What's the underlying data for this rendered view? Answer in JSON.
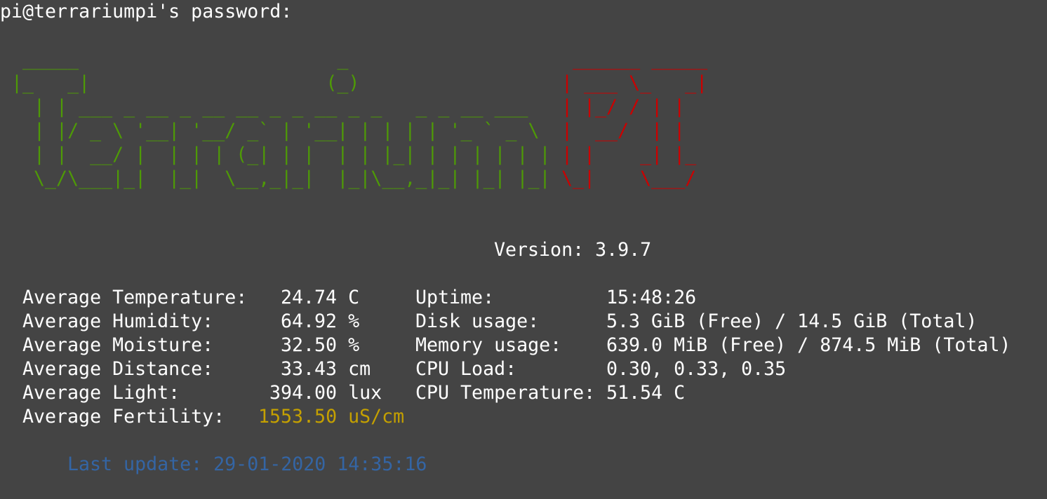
{
  "prompt": "pi@terrariumpi's password:",
  "logo": {
    "terrarium_lines": [
      "  _____                       _",
      " |_   _|                     (_)",
      "   | | ___ _ __ _ __ __ _ _ __ _ _   _ _ __ ___",
      "   | |/ _ \\ '__| '__/ _` | '__| | | | | '_ ` _ \\",
      "   | |  __/ |  | | | (_| | |  | | |_| | | | | | |",
      "   \\_/\\___|_|  |_|  \\__,_|_|  |_|\\__,_|_| |_| |_|"
    ],
    "pi_lines": [
      " ______ _____",
      "| ___ \\_   _|",
      "| |_/ / | |",
      "|  __/  | |",
      "| |    _| |_",
      "\\_|    \\___/"
    ]
  },
  "version": {
    "label": "Version:",
    "value": "3.9.7"
  },
  "sensors": [
    {
      "label": "Average Temperature:",
      "value": "24.74",
      "unit": "C",
      "highlight": false
    },
    {
      "label": "Average Humidity:",
      "value": "64.92",
      "unit": "%",
      "highlight": false
    },
    {
      "label": "Average Moisture:",
      "value": "32.50",
      "unit": "%",
      "highlight": false
    },
    {
      "label": "Average Distance:",
      "value": "33.43",
      "unit": "cm",
      "highlight": false
    },
    {
      "label": "Average Light:",
      "value": "394.00",
      "unit": "lux",
      "highlight": false
    },
    {
      "label": "Average Fertility:",
      "value": "1553.50",
      "unit": "uS/cm",
      "highlight": true
    }
  ],
  "system": [
    {
      "label": "Uptime:",
      "value": "15:48:26"
    },
    {
      "label": "Disk usage:",
      "value": "5.3 GiB (Free) / 14.5 GiB (Total)"
    },
    {
      "label": "Memory usage:",
      "value": "639.0 MiB (Free) / 874.5 MiB (Total)"
    },
    {
      "label": "CPU Load:",
      "value": "0.30, 0.33, 0.35"
    },
    {
      "label": "CPU Temperature:",
      "value": "51.54 C"
    }
  ],
  "last_update": {
    "label": "Last update:",
    "value": "29-01-2020 14:35:16"
  },
  "colors": {
    "background": "#444444",
    "text": "#ffffff",
    "logo_green": "#4e9a06",
    "logo_red": "#cc0000",
    "highlight_yellow": "#c4a000",
    "update_blue": "#3465a4"
  }
}
